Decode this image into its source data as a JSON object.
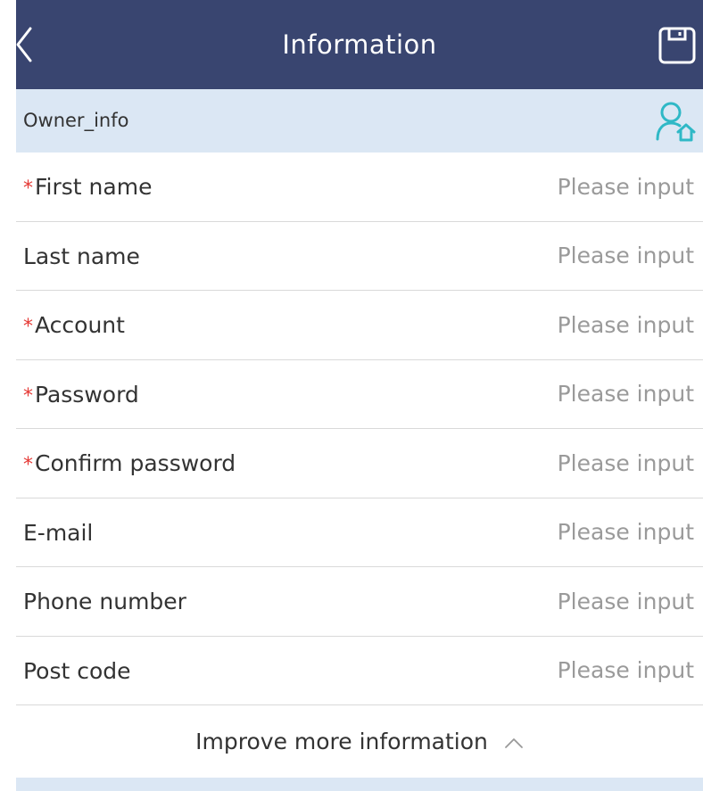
{
  "header": {
    "title": "Information",
    "back_icon": "chevron-left-icon",
    "save_icon": "save-icon",
    "background": "#394570"
  },
  "section": {
    "label": "Owner_info",
    "icon": "user-home-icon",
    "icon_color": "#2fb8c6",
    "background": "#dbe7f4"
  },
  "fields": [
    {
      "label": "First name",
      "required": true,
      "placeholder": "Please input",
      "value": ""
    },
    {
      "label": "Last name",
      "required": false,
      "placeholder": "Please input",
      "value": ""
    },
    {
      "label": "Account",
      "required": true,
      "placeholder": "Please input",
      "value": ""
    },
    {
      "label": "Password",
      "required": true,
      "placeholder": "Please input",
      "value": ""
    },
    {
      "label": "Confirm password",
      "required": true,
      "placeholder": "Please input",
      "value": ""
    },
    {
      "label": "E-mail",
      "required": false,
      "placeholder": "Please input",
      "value": ""
    },
    {
      "label": "Phone number",
      "required": false,
      "placeholder": "Please input",
      "value": ""
    },
    {
      "label": "Post code",
      "required": false,
      "placeholder": "Please input",
      "value": ""
    }
  ],
  "required_marker": "*",
  "required_color": "#e53935",
  "more": {
    "label": "Improve more information",
    "icon": "chevron-up-icon"
  }
}
